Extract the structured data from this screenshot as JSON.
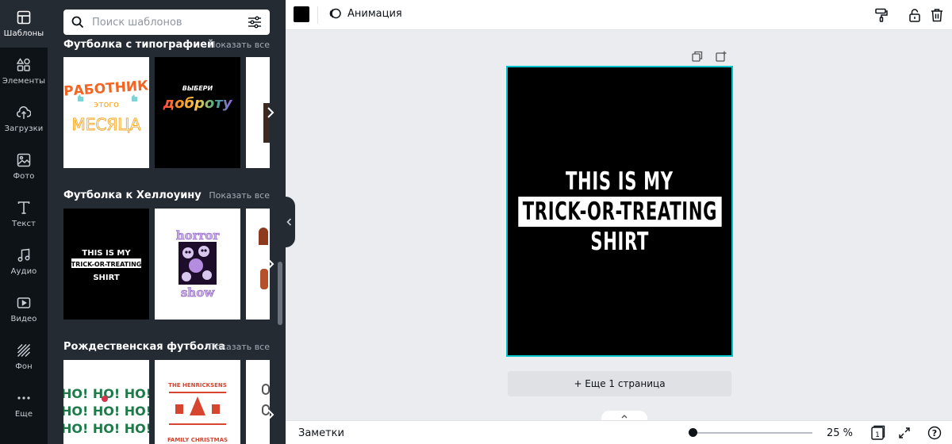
{
  "rail": {
    "items": [
      {
        "label": "Шаблоны",
        "icon": "templates-icon"
      },
      {
        "label": "Элементы",
        "icon": "elements-icon"
      },
      {
        "label": "Загрузки",
        "icon": "upload-icon"
      },
      {
        "label": "Фото",
        "icon": "photo-icon"
      },
      {
        "label": "Текст",
        "icon": "text-icon"
      },
      {
        "label": "Аудио",
        "icon": "music-icon"
      },
      {
        "label": "Видео",
        "icon": "video-icon"
      },
      {
        "label": "Фон",
        "icon": "background-icon"
      },
      {
        "label": "Еще",
        "icon": "more-icon"
      }
    ]
  },
  "panel": {
    "search_placeholder": "Поиск шаблонов",
    "sections": [
      {
        "title": "Футболка с типографией",
        "show_all": "Показать все",
        "thumbs": [
          {
            "lines": [
              "РАБОТНИК",
              "этого",
              "МЕСЯЦА"
            ]
          },
          {
            "lines": [
              "ВЫБЕРИ",
              "доброту"
            ]
          }
        ]
      },
      {
        "title": "Футболка к Хеллоуину",
        "show_all": "Показать все",
        "thumbs": [
          {
            "lines": [
              "THIS IS MY",
              "TRICK-OR-TREATING",
              "SHIRT"
            ]
          },
          {
            "lines": [
              "horror",
              "show"
            ]
          }
        ]
      },
      {
        "title": "Рождественская футболка",
        "show_all": "Показать все",
        "thumbs": [
          {
            "lines": [
              "HO! HO! HO!",
              "HO! HO! HO!",
              "HO! HO! HO!"
            ]
          },
          {
            "lines": [
              "THE HENRICKSENS",
              "FAMILY CHRISTMAS"
            ]
          }
        ]
      }
    ]
  },
  "toolbar": {
    "color": "#000000",
    "animation_label": "Анимация"
  },
  "canvas": {
    "lines": [
      "THIS IS MY",
      "TRICK-OR-TREATING",
      "SHIRT"
    ],
    "accent": "#00c4cc",
    "add_page_label": "+ Еще 1 страница"
  },
  "bottom": {
    "notes_label": "Заметки",
    "zoom": "25 %",
    "page_count": "1",
    "help": "?"
  }
}
